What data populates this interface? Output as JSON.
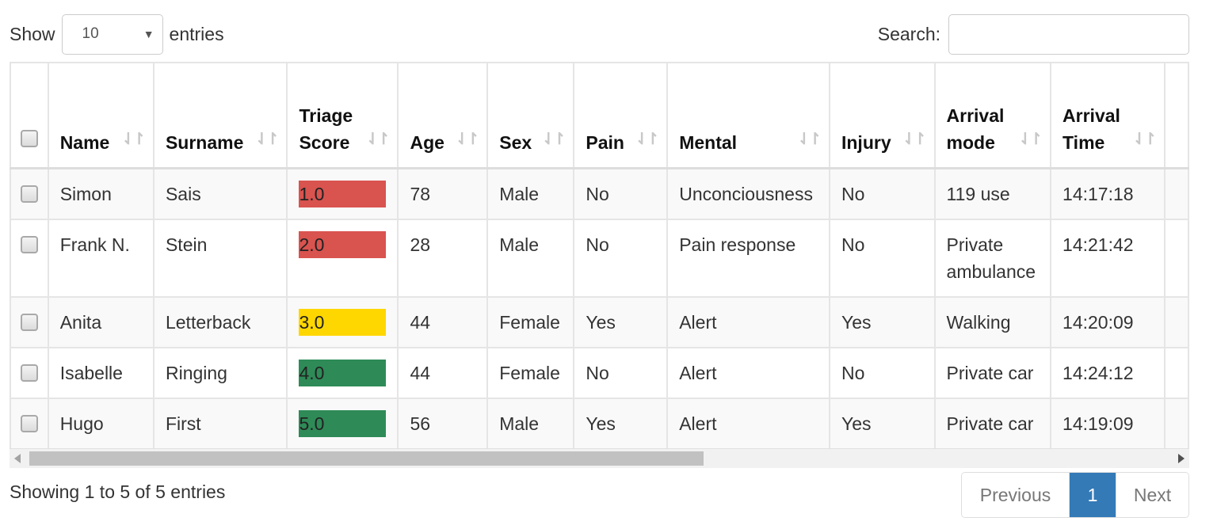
{
  "length_menu": {
    "show_label": "Show",
    "selected_value": "10",
    "entries_label": "entries"
  },
  "search": {
    "label": "Search:",
    "value": "",
    "placeholder": ""
  },
  "table": {
    "columns": [
      {
        "label": "Name"
      },
      {
        "label": "Surname"
      },
      {
        "label": "Triage Score"
      },
      {
        "label": "Age"
      },
      {
        "label": "Sex"
      },
      {
        "label": "Pain"
      },
      {
        "label": "Mental"
      },
      {
        "label": "Injury"
      },
      {
        "label": "Arrival mode"
      },
      {
        "label": "Arrival Time"
      }
    ],
    "rows": [
      {
        "checked": false,
        "name": "Simon",
        "surname": "Sais",
        "triage_score": "1.0",
        "triage_color": "#d9534f",
        "age": "78",
        "sex": "Male",
        "pain": "No",
        "mental": "Unconciousness",
        "injury": "No",
        "arrival_mode": "119 use",
        "arrival_time": "14:17:18"
      },
      {
        "checked": false,
        "name": "Frank N.",
        "surname": "Stein",
        "triage_score": "2.0",
        "triage_color": "#d9534f",
        "age": "28",
        "sex": "Male",
        "pain": "No",
        "mental": "Pain response",
        "injury": "No",
        "arrival_mode": "Private ambulance",
        "arrival_time": "14:21:42"
      },
      {
        "checked": false,
        "name": "Anita",
        "surname": "Letterback",
        "triage_score": "3.0",
        "triage_color": "#ffd700",
        "age": "44",
        "sex": "Female",
        "pain": "Yes",
        "mental": "Alert",
        "injury": "Yes",
        "arrival_mode": "Walking",
        "arrival_time": "14:20:09"
      },
      {
        "checked": false,
        "name": "Isabelle",
        "surname": "Ringing",
        "triage_score": "4.0",
        "triage_color": "#2e8b57",
        "age": "44",
        "sex": "Female",
        "pain": "No",
        "mental": "Alert",
        "injury": "No",
        "arrival_mode": "Private car",
        "arrival_time": "14:24:12"
      },
      {
        "checked": false,
        "name": "Hugo",
        "surname": "First",
        "triage_score": "5.0",
        "triage_color": "#2e8b57",
        "age": "56",
        "sex": "Male",
        "pain": "Yes",
        "mental": "Alert",
        "injury": "Yes",
        "arrival_mode": "Private car",
        "arrival_time": "14:19:09"
      }
    ],
    "select_all_checked": false,
    "sort_icon": "sort-both-icon"
  },
  "scrollbar": {
    "position_fraction": 0.0,
    "visible_fraction": 0.59
  },
  "footer": {
    "info": "Showing 1 to 5 of 5 entries",
    "pagination": {
      "previous_label": "Previous",
      "current_page": "1",
      "next_label": "Next"
    }
  },
  "colors": {
    "accent": "#337ab7",
    "triage_red": "#d9534f",
    "triage_yellow": "#ffd700",
    "triage_green": "#2e8b57"
  }
}
